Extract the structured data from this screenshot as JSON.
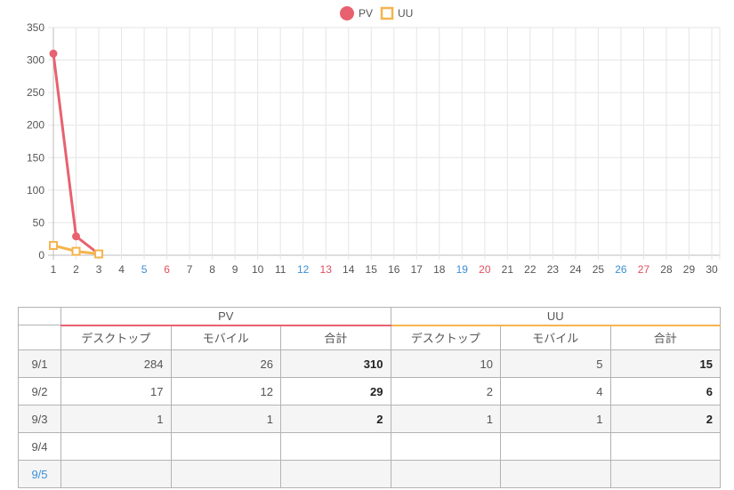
{
  "chart_data": {
    "type": "line",
    "x": [
      1,
      2,
      3,
      4,
      5,
      6,
      7,
      8,
      9,
      10,
      11,
      12,
      13,
      14,
      15,
      16,
      17,
      18,
      19,
      20,
      21,
      22,
      23,
      24,
      25,
      26,
      27,
      28,
      29,
      30
    ],
    "xticks": [
      "1",
      "2",
      "3",
      "4",
      "5",
      "6",
      "7",
      "8",
      "9",
      "10",
      "11",
      "12",
      "13",
      "14",
      "15",
      "16",
      "17",
      "18",
      "19",
      "20",
      "21",
      "22",
      "23",
      "24",
      "25",
      "26",
      "27",
      "28",
      "29",
      "30"
    ],
    "saturdays": [
      5,
      12,
      19,
      26
    ],
    "sundays": [
      6,
      13,
      20,
      27
    ],
    "ylim": [
      0,
      350
    ],
    "yticks": [
      0,
      50,
      100,
      150,
      200,
      250,
      300,
      350
    ],
    "grid": true,
    "legend_position": "top",
    "series": [
      {
        "name": "PV",
        "color": "#e8616f",
        "marker": "circle",
        "x": [
          1,
          2,
          3
        ],
        "values": [
          310,
          29,
          2
        ]
      },
      {
        "name": "UU",
        "color": "#f5b44e",
        "marker": "square",
        "x": [
          1,
          2,
          3
        ],
        "values": [
          15,
          6,
          2
        ]
      }
    ]
  },
  "table": {
    "groups": [
      {
        "label": "PV",
        "color": "#e8616f"
      },
      {
        "label": "UU",
        "color": "#f5b44e"
      }
    ],
    "columns": [
      "デスクトップ",
      "モバイル",
      "合計",
      "デスクトップ",
      "モバイル",
      "合計"
    ],
    "rows": [
      {
        "date": "9/1",
        "day": "weekday",
        "values": [
          "284",
          "26",
          "310",
          "10",
          "5",
          "15"
        ]
      },
      {
        "date": "9/2",
        "day": "weekday",
        "values": [
          "17",
          "12",
          "29",
          "2",
          "4",
          "6"
        ]
      },
      {
        "date": "9/3",
        "day": "weekday",
        "values": [
          "1",
          "1",
          "2",
          "1",
          "1",
          "2"
        ]
      },
      {
        "date": "9/4",
        "day": "weekday",
        "values": [
          "",
          "",
          "",
          "",
          "",
          ""
        ]
      },
      {
        "date": "9/5",
        "day": "saturday",
        "values": [
          "",
          "",
          "",
          "",
          "",
          ""
        ]
      }
    ]
  }
}
